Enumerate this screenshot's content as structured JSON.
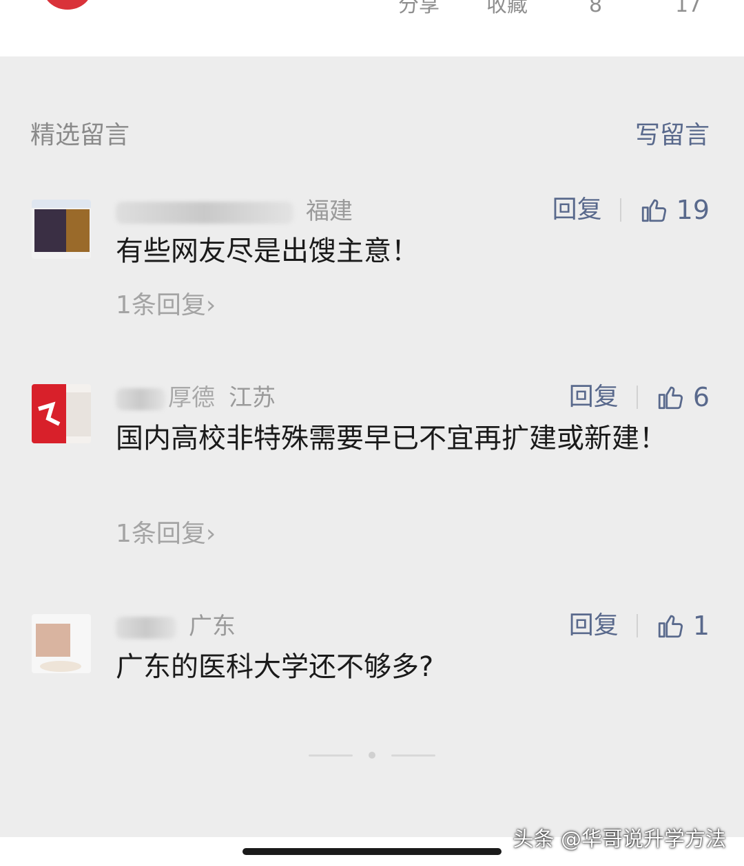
{
  "top_bar": {
    "share_label": "分享",
    "favorite_label": "收藏",
    "count_a": "8",
    "count_b": "17"
  },
  "section": {
    "title": "精选留言",
    "write_label": "写留言"
  },
  "comments": [
    {
      "name_visible": "",
      "location": "福建",
      "reply_label": "回复",
      "likes": "19",
      "text": "有些网友尽是出馊主意！",
      "replies_label": "1条回复"
    },
    {
      "name_visible": "厚德",
      "location": "江苏",
      "reply_label": "回复",
      "likes": "6",
      "text": "国内高校非特殊需要早已不宜再扩建或新建！",
      "replies_label": "1条回复"
    },
    {
      "name_visible": "",
      "location": "广东",
      "reply_label": "回复",
      "likes": "1",
      "text": "广东的医科大学还不够多?",
      "replies_label": ""
    }
  ],
  "watermark": "头条 @华哥说升学方法",
  "colors": {
    "link": "#59698c",
    "background": "#ededed",
    "text": "#1a1a1a"
  }
}
